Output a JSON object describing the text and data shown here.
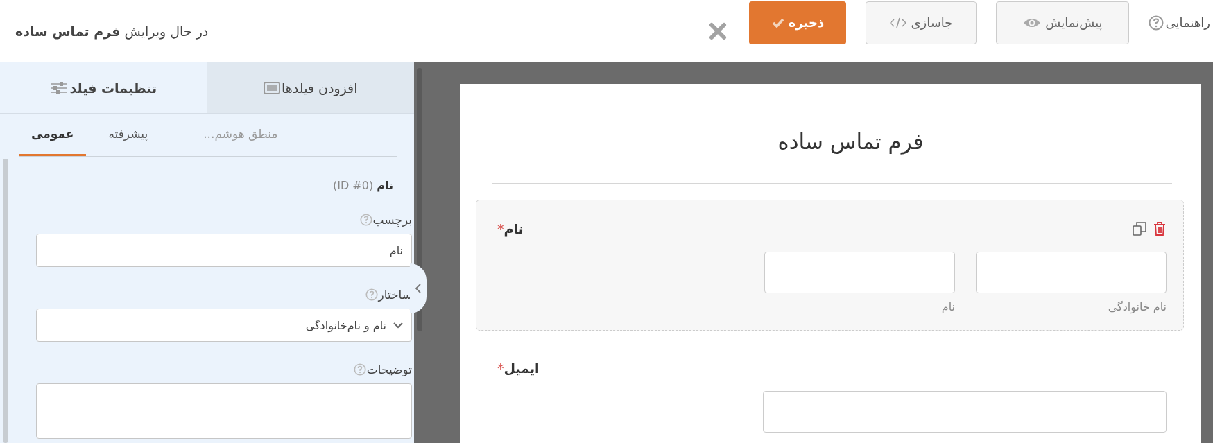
{
  "header": {
    "prefix": "در حال ویرایش",
    "form_name": "فرم تماس ساده"
  },
  "toolbar": [
    {
      "kind": "help",
      "label": "راهنمایی"
    },
    {
      "kind": "preview",
      "label": "پیش‌نمایش"
    },
    {
      "kind": "embed",
      "label": "جاسازی"
    },
    {
      "kind": "save",
      "label": "ذخیره"
    }
  ],
  "sidebar": {
    "tabs": [
      {
        "label": "افزودن فیلدها",
        "selected": false
      },
      {
        "label": "تنظیمات فیلد",
        "selected": true
      }
    ],
    "subtabs": [
      {
        "label": "منطق هوشم...",
        "selected": false,
        "disabled": true
      },
      {
        "label": "پیشرفته",
        "selected": false,
        "disabled": false
      },
      {
        "label": "عمومی",
        "selected": true,
        "disabled": false
      }
    ],
    "field_name": "نام",
    "field_id": "(ID #0)",
    "settings": [
      {
        "kind": "text",
        "label": "برچسب",
        "value": "نام"
      },
      {
        "kind": "select",
        "label": "ساختار",
        "value": "نام و نام‌خانوادگی"
      },
      {
        "kind": "textarea",
        "label": "توضیحات"
      }
    ]
  },
  "form": {
    "title": "فرم تماس ساده",
    "required_mark": "*",
    "fields": [
      {
        "kind": "name",
        "label": "نام",
        "required": true,
        "selected": true,
        "sublabels": [
          "نام خانوادگی",
          "نام"
        ]
      },
      {
        "kind": "email",
        "label": "ایمیل",
        "required": true,
        "selected": false
      }
    ]
  }
}
